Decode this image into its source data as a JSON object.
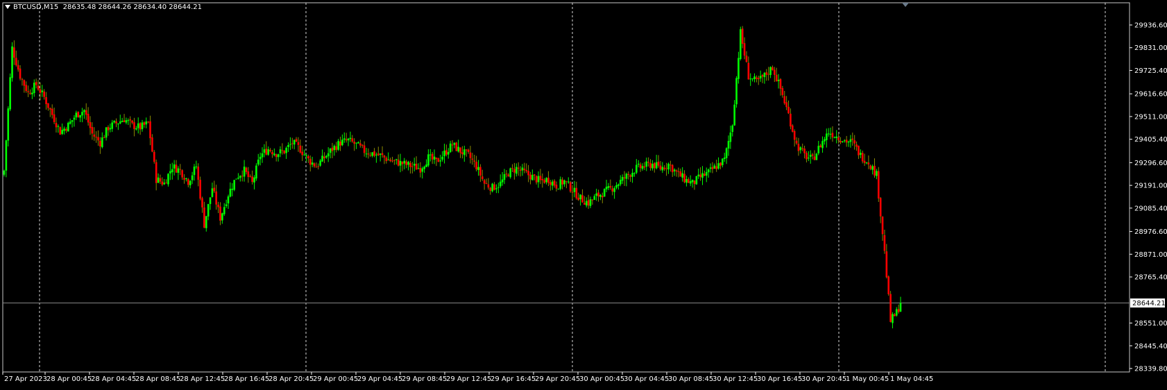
{
  "header": {
    "symbol": "BTCUSD,M15",
    "ohlc": "28635.48 28644.26 28634.40 28644.21"
  },
  "current_price_label": "28644.21",
  "colors": {
    "background": "#000000",
    "bull": "#00ff00",
    "bear": "#ff0000",
    "grid": "#ffffff",
    "axis": "#ffffff",
    "price_line": "#8a8a8a",
    "bull_wick": "#00ff00",
    "bear_wick": "#8b8b00"
  },
  "chart_data": {
    "type": "candlestick",
    "timeframe": "M15",
    "ylim": [
      28339.8,
      29936.6
    ],
    "y_tick_labels": [
      "29936.60",
      "29831.00",
      "29725.40",
      "29616.60",
      "29511.00",
      "29405.40",
      "29296.60",
      "29191.00",
      "29085.40",
      "28976.60",
      "28871.00",
      "28765.40",
      "28644.21",
      "28551.00",
      "28445.40",
      "28339.80"
    ],
    "x_tick_labels": [
      "27 Apr 2023",
      "28 Apr 00:45",
      "28 Apr 04:45",
      "28 Apr 08:45",
      "28 Apr 12:45",
      "28 Apr 16:45",
      "28 Apr 20:45",
      "29 Apr 00:45",
      "29 Apr 04:45",
      "29 Apr 08:45",
      "29 Apr 12:45",
      "29 Apr 16:45",
      "29 Apr 20:45",
      "30 Apr 00:45",
      "30 Apr 04:45",
      "30 Apr 08:45",
      "30 Apr 12:45",
      "30 Apr 16:45",
      "30 Apr 20:45",
      "1 May 00:45",
      "1 May 04:45"
    ],
    "last_price": 28644.21,
    "close_anchors": [
      [
        0,
        29260
      ],
      [
        4,
        29830
      ],
      [
        8,
        29700
      ],
      [
        12,
        29620
      ],
      [
        16,
        29660
      ],
      [
        20,
        29600
      ],
      [
        24,
        29520
      ],
      [
        28,
        29440
      ],
      [
        32,
        29470
      ],
      [
        36,
        29520
      ],
      [
        40,
        29540
      ],
      [
        44,
        29430
      ],
      [
        48,
        29390
      ],
      [
        52,
        29460
      ],
      [
        56,
        29480
      ],
      [
        60,
        29500
      ],
      [
        64,
        29470
      ],
      [
        68,
        29460
      ],
      [
        72,
        29480
      ],
      [
        76,
        29220
      ],
      [
        80,
        29200
      ],
      [
        84,
        29280
      ],
      [
        88,
        29260
      ],
      [
        92,
        29210
      ],
      [
        96,
        29280
      ],
      [
        100,
        29010
      ],
      [
        104,
        29180
      ],
      [
        108,
        29040
      ],
      [
        112,
        29150
      ],
      [
        116,
        29230
      ],
      [
        120,
        29260
      ],
      [
        124,
        29200
      ],
      [
        128,
        29330
      ],
      [
        132,
        29360
      ],
      [
        136,
        29340
      ],
      [
        140,
        29350
      ],
      [
        144,
        29390
      ],
      [
        148,
        29360
      ],
      [
        152,
        29310
      ],
      [
        156,
        29280
      ],
      [
        160,
        29320
      ],
      [
        164,
        29360
      ],
      [
        168,
        29390
      ],
      [
        172,
        29400
      ],
      [
        176,
        29380
      ],
      [
        180,
        29350
      ],
      [
        184,
        29340
      ],
      [
        188,
        29330
      ],
      [
        192,
        29310
      ],
      [
        196,
        29300
      ],
      [
        200,
        29290
      ],
      [
        204,
        29280
      ],
      [
        208,
        29270
      ],
      [
        212,
        29320
      ],
      [
        216,
        29300
      ],
      [
        220,
        29340
      ],
      [
        224,
        29380
      ],
      [
        228,
        29350
      ],
      [
        232,
        29330
      ],
      [
        236,
        29280
      ],
      [
        240,
        29200
      ],
      [
        244,
        29180
      ],
      [
        248,
        29200
      ],
      [
        252,
        29250
      ],
      [
        256,
        29270
      ],
      [
        260,
        29250
      ],
      [
        264,
        29230
      ],
      [
        268,
        29210
      ],
      [
        272,
        29220
      ],
      [
        276,
        29190
      ],
      [
        280,
        29210
      ],
      [
        284,
        29170
      ],
      [
        288,
        29130
      ],
      [
        292,
        29110
      ],
      [
        296,
        29140
      ],
      [
        300,
        29160
      ],
      [
        304,
        29180
      ],
      [
        308,
        29210
      ],
      [
        312,
        29240
      ],
      [
        316,
        29270
      ],
      [
        320,
        29280
      ],
      [
        324,
        29290
      ],
      [
        328,
        29270
      ],
      [
        332,
        29290
      ],
      [
        336,
        29250
      ],
      [
        340,
        29220
      ],
      [
        344,
        29200
      ],
      [
        348,
        29230
      ],
      [
        352,
        29250
      ],
      [
        356,
        29280
      ],
      [
        360,
        29310
      ],
      [
        364,
        29480
      ],
      [
        368,
        29900
      ],
      [
        372,
        29700
      ],
      [
        376,
        29670
      ],
      [
        380,
        29700
      ],
      [
        384,
        29740
      ],
      [
        388,
        29640
      ],
      [
        392,
        29520
      ],
      [
        396,
        29380
      ],
      [
        400,
        29330
      ],
      [
        404,
        29310
      ],
      [
        408,
        29380
      ],
      [
        412,
        29440
      ],
      [
        416,
        29420
      ],
      [
        420,
        29400
      ],
      [
        424,
        29390
      ],
      [
        428,
        29330
      ],
      [
        432,
        29300
      ],
      [
        436,
        29240
      ],
      [
        440,
        28880
      ],
      [
        443,
        28560
      ],
      [
        446,
        28600
      ],
      [
        448,
        28644.21
      ]
    ]
  }
}
